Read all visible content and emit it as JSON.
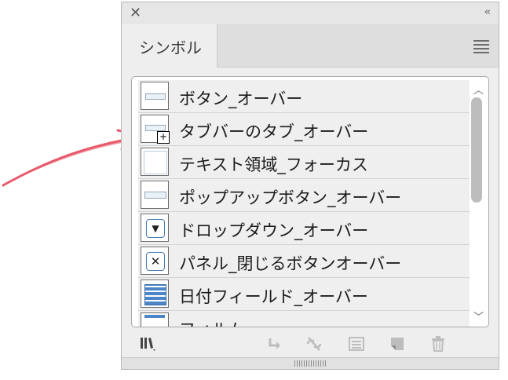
{
  "panel": {
    "title": "シンボル",
    "close_icon": "close-icon",
    "collapse_icon": "collapse-double-chevron-icon",
    "menu_icon": "panel-menu-icon"
  },
  "symbols": [
    {
      "label": "ボタン_オーバー",
      "icon": "button-thumbnail"
    },
    {
      "label": "タブバーのタブ_オーバー",
      "icon": "tab-bar-thumbnail-with-add-badge"
    },
    {
      "label": "テキスト領域_フォーカス",
      "icon": "text-area-thumbnail"
    },
    {
      "label": "ポップアップボタン_オーバー",
      "icon": "popup-button-thumbnail"
    },
    {
      "label": "ドロップダウン_オーバー",
      "icon": "dropdown-thumbnail"
    },
    {
      "label": "パネル_閉じるボタンオーバー",
      "icon": "close-button-thumbnail"
    },
    {
      "label": "日付フィールド_オーバー",
      "icon": "calendar-thumbnail"
    },
    {
      "label": "フィルム",
      "icon": "film-thumbnail"
    }
  ],
  "footer": {
    "icons": [
      "symbol-library-icon",
      "place-symbol-icon",
      "break-link-icon",
      "symbol-options-icon",
      "new-symbol-icon",
      "delete-icon"
    ]
  },
  "colors": {
    "accent_arrow": "#e85a6b",
    "panel_bg": "#eeeeee"
  }
}
